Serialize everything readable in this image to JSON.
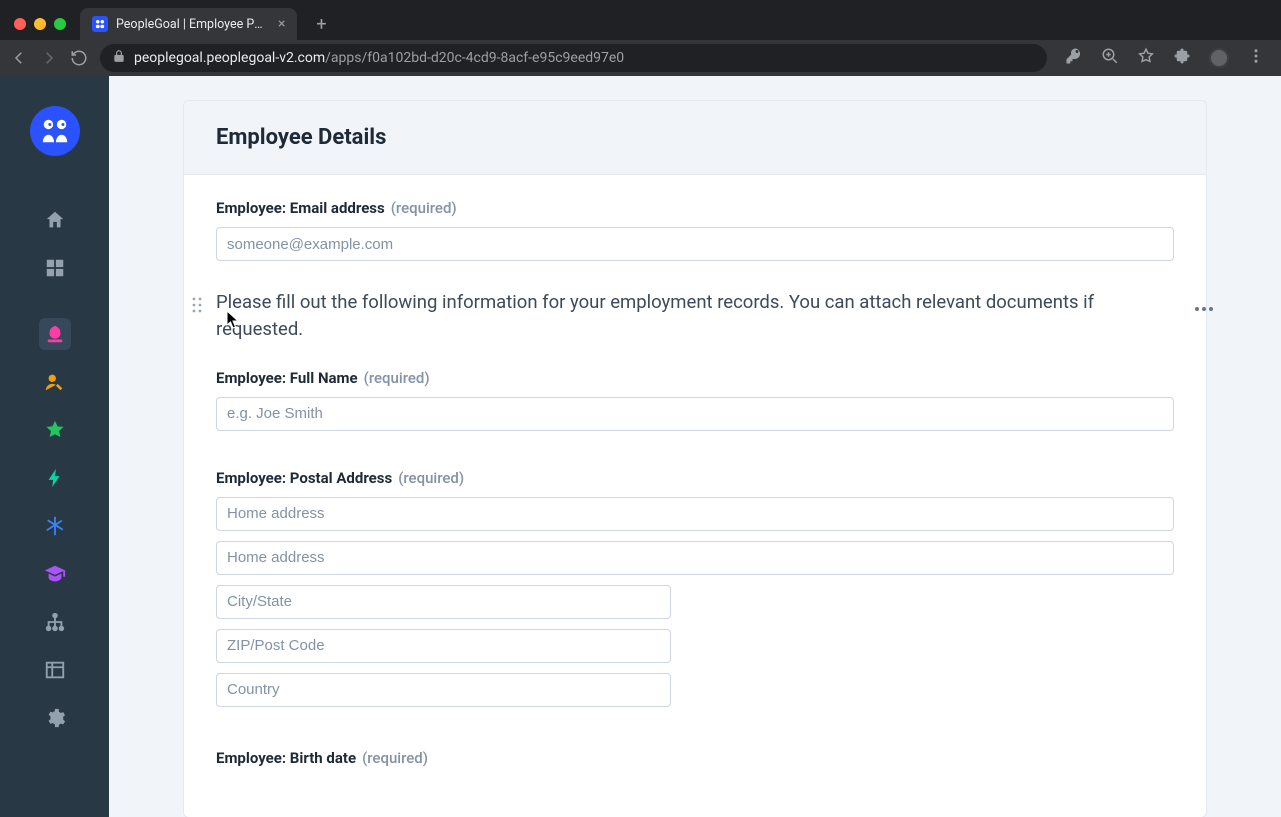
{
  "browser": {
    "tab_title": "PeopleGoal | Employee Pre-On",
    "url_host": "peoplegoal.peoplegoal-v2.com",
    "url_path": "/apps/f0a102bd-d20c-4cd9-8acf-e95c9eed97e0"
  },
  "page": {
    "header": "Employee Details",
    "info_text": "Please fill out the following information for your employment records. You can attach relevant documents if requested.",
    "required_text": "(required)",
    "fields": {
      "email": {
        "label": "Employee: Email address",
        "placeholder": "someone@example.com",
        "value": ""
      },
      "fullname": {
        "label": "Employee: Full Name",
        "placeholder": "e.g. Joe Smith",
        "value": ""
      },
      "postal": {
        "label": "Employee: Postal Address",
        "addr1_placeholder": "Home address",
        "addr2_placeholder": "Home address",
        "city_placeholder": "City/State",
        "zip_placeholder": "ZIP/Post Code",
        "country_placeholder": "Country"
      },
      "birthdate": {
        "label": "Employee: Birth date"
      }
    }
  },
  "sidebar": {
    "items": [
      {
        "name": "home"
      },
      {
        "name": "apps"
      },
      {
        "name": "app-pink",
        "color": "#ff3ea5"
      },
      {
        "name": "person-edit",
        "color": "#f59e0b"
      },
      {
        "name": "star",
        "color": "#22c55e"
      },
      {
        "name": "bolt",
        "color": "#06d6a0"
      },
      {
        "name": "asterisk",
        "color": "#3b82f6"
      },
      {
        "name": "grad-cap",
        "color": "#a855f7"
      },
      {
        "name": "org-chart"
      },
      {
        "name": "table"
      },
      {
        "name": "settings"
      }
    ]
  }
}
